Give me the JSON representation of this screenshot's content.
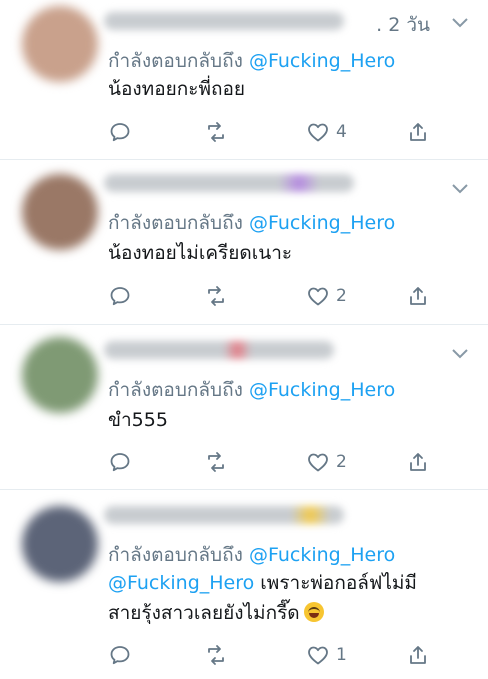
{
  "replying_label": "กำลังตอบกลับถึง",
  "tweets": [
    {
      "time": ". 2 วัน",
      "mention": "@Fucking_Hero",
      "text": "น้องทอยกะพี่ถอย",
      "likes": "4"
    },
    {
      "mention": "@Fucking_Hero",
      "text": "น้องทอยไม่เครียดเนาะ",
      "likes": "2"
    },
    {
      "mention": "@Fucking_Hero",
      "text": "ขำ555",
      "likes": "2"
    },
    {
      "mention": "@Fucking_Hero",
      "text_mention": "@Fucking_Hero",
      "text": " เพราะพ่อกอล์ฟไม่มีสายรุ้งสาวเลยยังไม่กรี๊ด",
      "likes": "1",
      "emoji": "grinning-squinting-face"
    }
  ],
  "colors": {
    "link": "#1da1f2",
    "muted": "#657786",
    "text": "#14171a",
    "divider": "#e6ecf0"
  }
}
